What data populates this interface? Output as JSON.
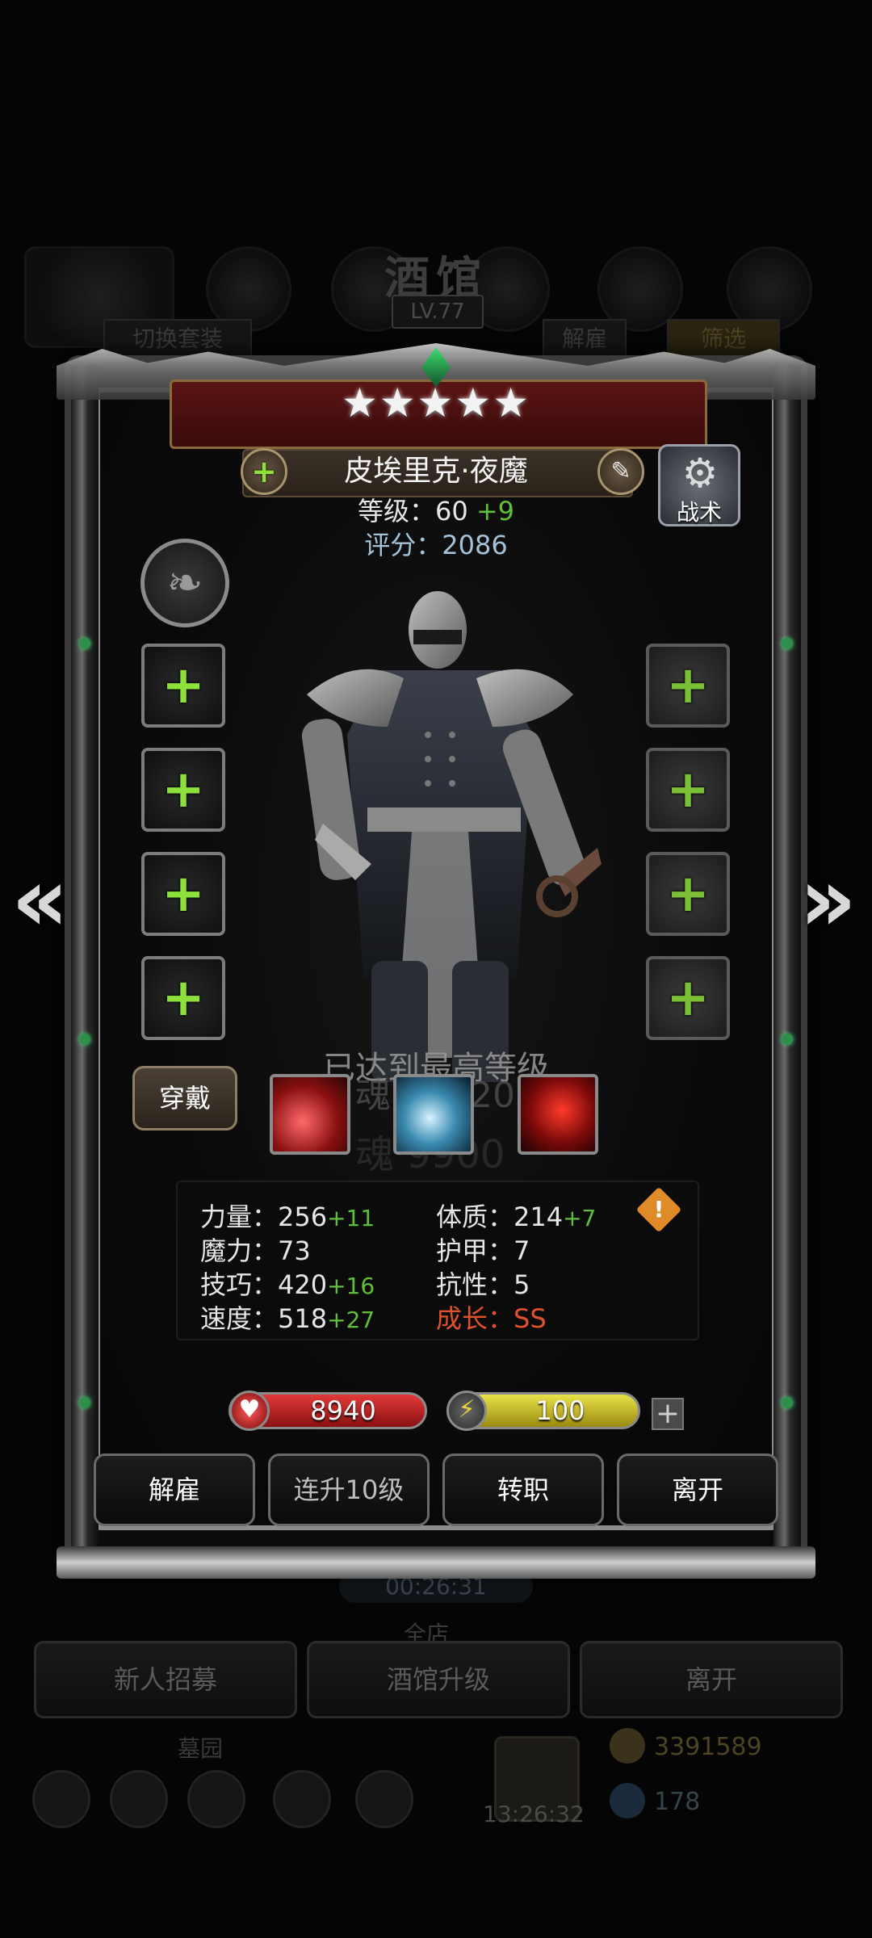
{
  "background": {
    "title": "酒馆",
    "level": "LV.77",
    "switch_outfit": "切换套装",
    "dismiss_tab": "解雇",
    "filter_tab": "筛选",
    "timer": "00:26:31",
    "recruit_button": "新人招募",
    "upgrade_button": "酒馆升级",
    "leave_button": "离开",
    "cemetery_label": "墓园",
    "all_label": "全店",
    "clock": "13:26:32",
    "gold": "3391589",
    "gems": "178"
  },
  "hero": {
    "stars": "★★★★★",
    "name": "皮埃里克·夜魔",
    "level_label": "等级：60",
    "level_bonus": "+9",
    "score_label": "评分：2086",
    "tactics_label": "战术",
    "max_level_notice": "已达到最高等级",
    "soul_cost_1": "魂 10620",
    "soul_cost_2": "魂 9900"
  },
  "actions": {
    "wear": "穿戴",
    "dismiss": "解雇",
    "level_up_10": "连升10级",
    "change_class": "转职",
    "leave": "离开"
  },
  "stats": {
    "strength": {
      "label": "力量：256",
      "bonus": "+11"
    },
    "magic": {
      "label": "魔力：73",
      "bonus": ""
    },
    "skill": {
      "label": "技巧：420",
      "bonus": "+16"
    },
    "speed": {
      "label": "速度：518",
      "bonus": "+27"
    },
    "constitution": {
      "label": "体质：214",
      "bonus": "+7"
    },
    "armor": {
      "label": "护甲：7",
      "bonus": ""
    },
    "resistance": {
      "label": "抗性：5",
      "bonus": ""
    },
    "growth": {
      "label": "成长：SS",
      "bonus": ""
    }
  },
  "resources": {
    "hp": "8940",
    "energy": "100"
  },
  "colors": {
    "bonus_green": "#5fbf3a",
    "growth_red": "#e0522e",
    "hp_red": "#e23a3a",
    "energy_yellow": "#e8e24a"
  }
}
